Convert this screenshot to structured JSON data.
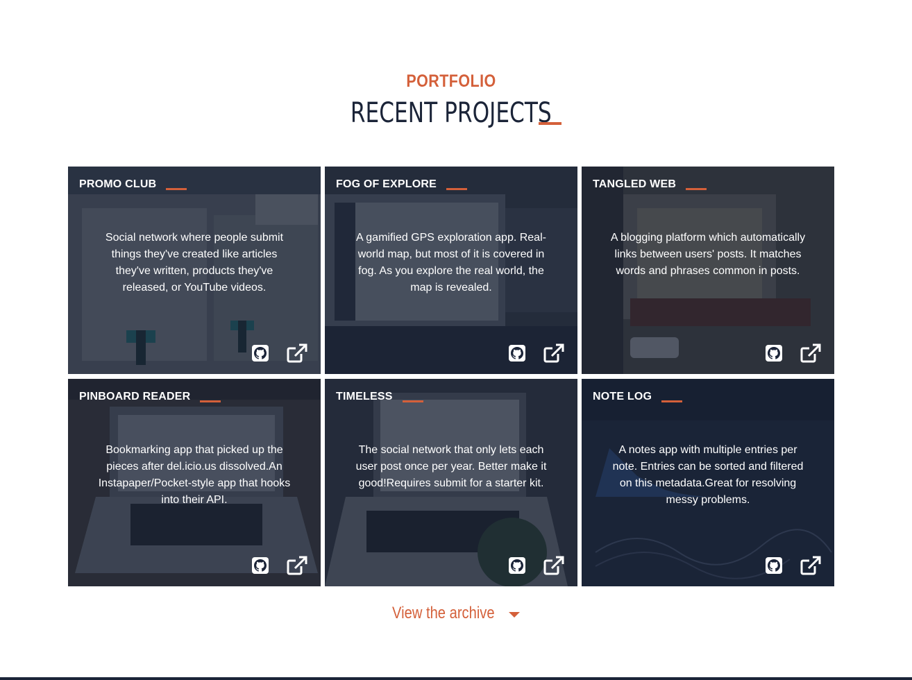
{
  "header": {
    "eyebrow": "PORTFOLIO",
    "title": "RECENT PROJECTS"
  },
  "projects": [
    {
      "title": "PROMO CLUB",
      "description": "Social network where people submit things they've created like articles they've written, products they've released, or YouTube videos.",
      "github_icon": "github-icon",
      "link_icon": "external-link-icon"
    },
    {
      "title": "FOG OF EXPLORE",
      "description": "A gamified GPS exploration app. Real-world map, but most of it is covered in fog. As you explore the real world, the map is revealed.",
      "github_icon": "github-icon",
      "link_icon": "external-link-icon"
    },
    {
      "title": "TANGLED WEB",
      "description": "A blogging platform which automatically links between users' posts. It matches words and phrases common in posts.",
      "github_icon": "github-icon",
      "link_icon": "external-link-icon"
    },
    {
      "title": "PINBOARD READER",
      "description": "Bookmarking app that picked up the pieces after del.icio.us dissolved.An Instapaper/Pocket-style app that hooks into their API.",
      "github_icon": "github-icon",
      "link_icon": "external-link-icon"
    },
    {
      "title": "TIMELESS",
      "description": "The social network that only lets each user post once per year. Better make it good!Requires submit for a starter kit.",
      "github_icon": "github-icon",
      "link_icon": "external-link-icon"
    },
    {
      "title": "NOTE LOG",
      "description": "A notes app with multiple entries per note. Entries can be sorted and filtered on this metadata.Great for resolving messy problems.",
      "github_icon": "github-icon",
      "link_icon": "external-link-icon"
    }
  ],
  "archive": {
    "label": "View the archive",
    "icon": "caret-down-icon"
  },
  "colors": {
    "accent": "#d4603a",
    "navy": "#1b2438",
    "card_overlay": "#161e30"
  }
}
